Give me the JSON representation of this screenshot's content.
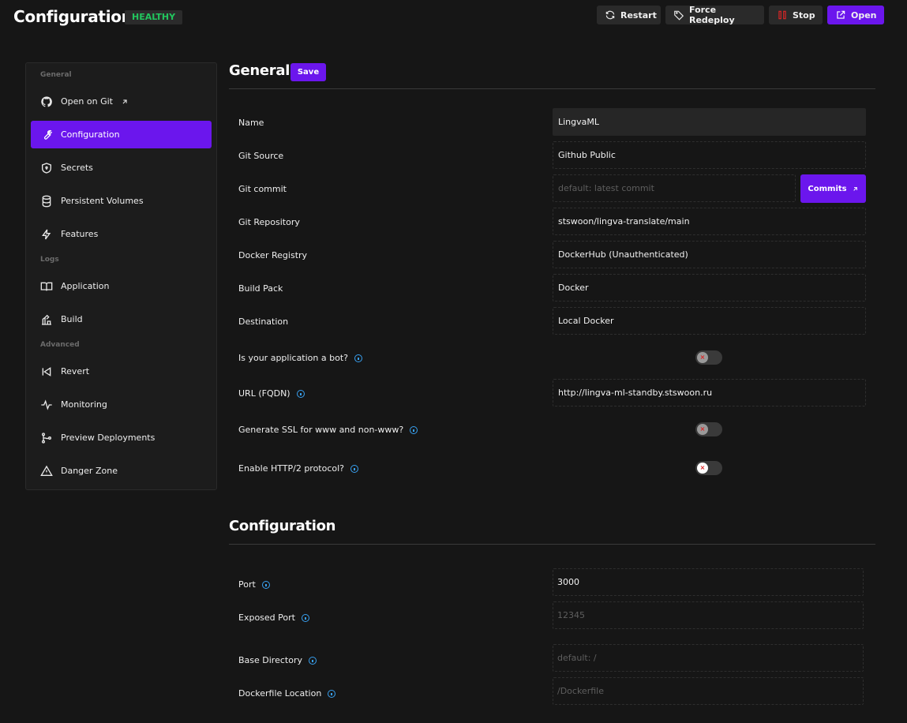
{
  "header": {
    "title": "Configurations",
    "status": "HEALTHY",
    "actions": {
      "restart": "Restart",
      "force_redeploy": "Force Redeploy",
      "stop": "Stop",
      "open": "Open"
    }
  },
  "sidebar": {
    "sections": [
      "General",
      "Logs",
      "Advanced"
    ],
    "items": [
      {
        "label": "Open on Git",
        "icon": "github-icon"
      },
      {
        "label": "Configuration",
        "icon": "wrench-icon",
        "active": true
      },
      {
        "label": "Secrets",
        "icon": "shield-icon"
      },
      {
        "label": "Persistent Volumes",
        "icon": "database-icon"
      },
      {
        "label": "Features",
        "icon": "bolt-icon"
      },
      {
        "label": "Application",
        "icon": "book-icon"
      },
      {
        "label": "Build",
        "icon": "build-icon"
      },
      {
        "label": "Revert",
        "icon": "revert-icon"
      },
      {
        "label": "Monitoring",
        "icon": "heartbeat-icon"
      },
      {
        "label": "Preview Deployments",
        "icon": "git-branch-icon"
      },
      {
        "label": "Danger Zone",
        "icon": "warning-icon"
      }
    ]
  },
  "general": {
    "title": "General",
    "save_label": "Save",
    "fields": {
      "name": {
        "label": "Name",
        "value": "LingvaML"
      },
      "git_source": {
        "label": "Git Source",
        "value": "Github Public"
      },
      "git_commit": {
        "label": "Git commit",
        "placeholder": "default: latest commit",
        "button": "Commits"
      },
      "git_repository": {
        "label": "Git Repository",
        "value": "stswoon/lingva-translate/main"
      },
      "docker_registry": {
        "label": "Docker Registry",
        "value": "DockerHub (Unauthenticated)"
      },
      "build_pack": {
        "label": "Build Pack",
        "value": "Docker"
      },
      "destination": {
        "label": "Destination",
        "value": "Local Docker"
      },
      "is_bot": {
        "label": "Is your application a bot?",
        "enabled": false
      },
      "url": {
        "label": "URL (FQDN)",
        "value": "http://lingva-ml-standby.stswoon.ru"
      },
      "ssl_www": {
        "label": "Generate SSL for www and non-www?",
        "enabled": false
      },
      "http2": {
        "label": "Enable HTTP/2 protocol?",
        "enabled": false
      }
    }
  },
  "configuration": {
    "title": "Configuration",
    "fields": {
      "port": {
        "label": "Port",
        "value": "3000"
      },
      "exposed_port": {
        "label": "Exposed Port",
        "placeholder": "12345"
      },
      "base_directory": {
        "label": "Base Directory",
        "placeholder": "default: /"
      },
      "dockerfile_location": {
        "label": "Dockerfile Location",
        "placeholder": "/Dockerfile"
      }
    }
  },
  "colors": {
    "accent": "#6b16ed",
    "healthy": "#22c55e",
    "stop": "#dc2626",
    "info": "#38a0f0"
  }
}
